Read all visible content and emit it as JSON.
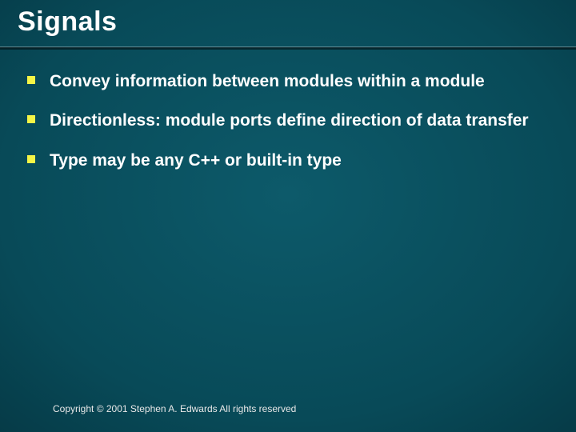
{
  "slide": {
    "title": "Signals",
    "bullets": [
      "Convey information between modules within a module",
      "Directionless: module ports define direction of data transfer",
      "Type may be any C++ or built-in type"
    ],
    "footer": "Copyright © 2001 Stephen A. Edwards  All rights reserved"
  }
}
